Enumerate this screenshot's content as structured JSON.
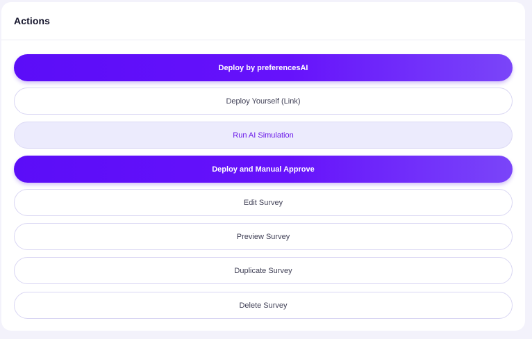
{
  "panel": {
    "title": "Actions"
  },
  "actions": [
    {
      "label": "Deploy by preferencesAI",
      "style": "primary"
    },
    {
      "label": "Deploy Yourself (Link)",
      "style": "outline"
    },
    {
      "label": "Run AI Simulation",
      "style": "soft"
    },
    {
      "label": "Deploy and Manual Approve",
      "style": "primary"
    },
    {
      "label": "Edit Survey",
      "style": "outline"
    },
    {
      "label": "Preview Survey",
      "style": "outline"
    },
    {
      "label": "Duplicate Survey",
      "style": "outline"
    },
    {
      "label": "Delete Survey",
      "style": "outline"
    }
  ],
  "colors": {
    "primary": "#5b0df8",
    "primary_end": "#7a45f9",
    "soft_bg": "#ecebfd",
    "soft_text": "#6a18e8",
    "border": "#d9d6f3"
  }
}
